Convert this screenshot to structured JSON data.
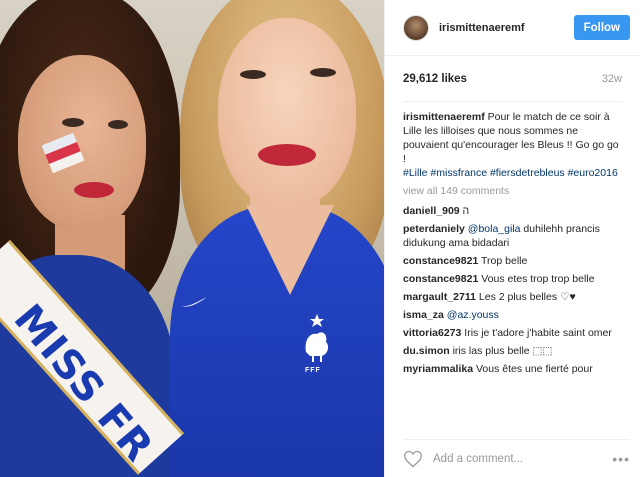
{
  "header": {
    "username": "irismittenaeremf",
    "follow_label": "Follow"
  },
  "stats": {
    "likes": "29,612 likes",
    "age": "32w"
  },
  "caption": {
    "user": "irismittenaeremf",
    "text": "Pour le match de ce soir à Lille les lilloises que nous sommes ne pouvaient qu'encourager les Bleus !! Go go go !",
    "hashtags": "#Lille #missfrance #fiersdetrebleus #euro2016"
  },
  "view_all": "view all 149 comments",
  "comments": [
    {
      "user": "daniell_909",
      "text": "ה"
    },
    {
      "user": "peterdaniely",
      "mention": "@bola_gila",
      "text": "duhilehh prancis didukung ama bidadari"
    },
    {
      "user": "constance9821",
      "text": "Trop belle"
    },
    {
      "user": "constance9821",
      "text": "Vous etes trop trop belle"
    },
    {
      "user": "margault_2711",
      "text": "Les 2 plus belles ♡♥"
    },
    {
      "user": "isma_za",
      "mention": "@az.youss",
      "text": ""
    },
    {
      "user": "vittoria6273",
      "text": "Iris je t'adore j'habite saint omer"
    },
    {
      "user": "du.simon",
      "text": "iris las plus belle ⬚⬚"
    },
    {
      "user": "myriammalika",
      "text": "Vous êtes une fierté pour"
    }
  ],
  "add_comment": {
    "placeholder": "Add a comment...",
    "more": "•••"
  },
  "photo": {
    "sash_text": "MISS FR",
    "crest_text": "FFF"
  },
  "colors": {
    "follow_button": "#3897f0",
    "hashtag": "#003569",
    "jersey": "#1f40bd"
  }
}
